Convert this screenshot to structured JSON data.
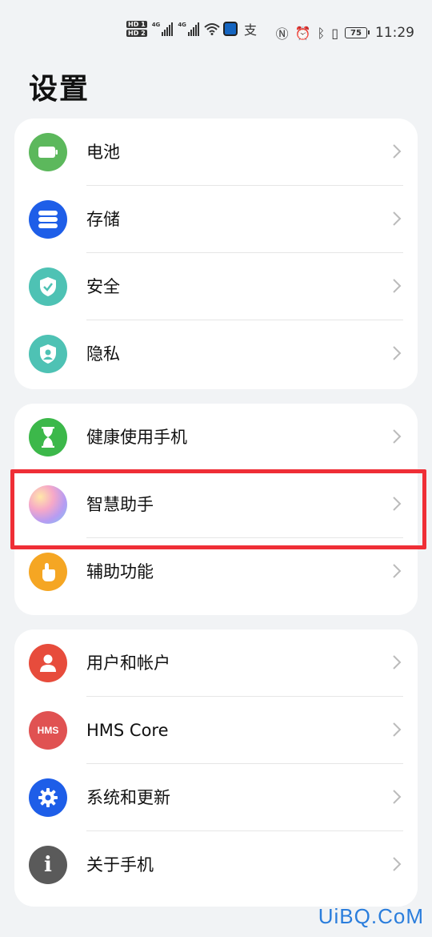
{
  "status_bar": {
    "sim1": "HD 1",
    "sim2": "HD 2",
    "net1": "4G",
    "net2": "4G",
    "battery": "75",
    "time": "11:29",
    "icons": [
      "nfc-icon",
      "alarm-icon",
      "bluetooth-icon",
      "vibrate-icon"
    ]
  },
  "page": {
    "title": "设置"
  },
  "groups": [
    {
      "items": [
        {
          "label": "电池",
          "icon": "battery-icon",
          "color": "#5cb85c"
        },
        {
          "label": "存储",
          "icon": "storage-icon",
          "color": "#1e5ee8"
        },
        {
          "label": "安全",
          "icon": "shield-icon",
          "color": "#4ec2b4"
        },
        {
          "label": "隐私",
          "icon": "privacy-icon",
          "color": "#4ec2b4"
        }
      ]
    },
    {
      "items": [
        {
          "label": "健康使用手机",
          "icon": "hourglass-icon",
          "color": "#3cb84a"
        },
        {
          "label": "智慧助手",
          "icon": "assistant-icon",
          "color": "#c8a8f0"
        },
        {
          "label": "辅助功能",
          "icon": "hand-icon",
          "color": "#f5a623"
        }
      ]
    },
    {
      "items": [
        {
          "label": "用户和帐户",
          "icon": "user-icon",
          "color": "#e74c3c"
        },
        {
          "label": "HMS Core",
          "icon": "hms-icon",
          "color": "#e05252",
          "icon_text": "HMS"
        },
        {
          "label": "系统和更新",
          "icon": "gear-icon",
          "color": "#1e5ee8"
        },
        {
          "label": "关于手机",
          "icon": "info-icon",
          "color": "#5a5a5a",
          "icon_text": "i"
        }
      ]
    }
  ],
  "highlight_color": "#ef2e36",
  "watermark": "UiBQ.CoM"
}
